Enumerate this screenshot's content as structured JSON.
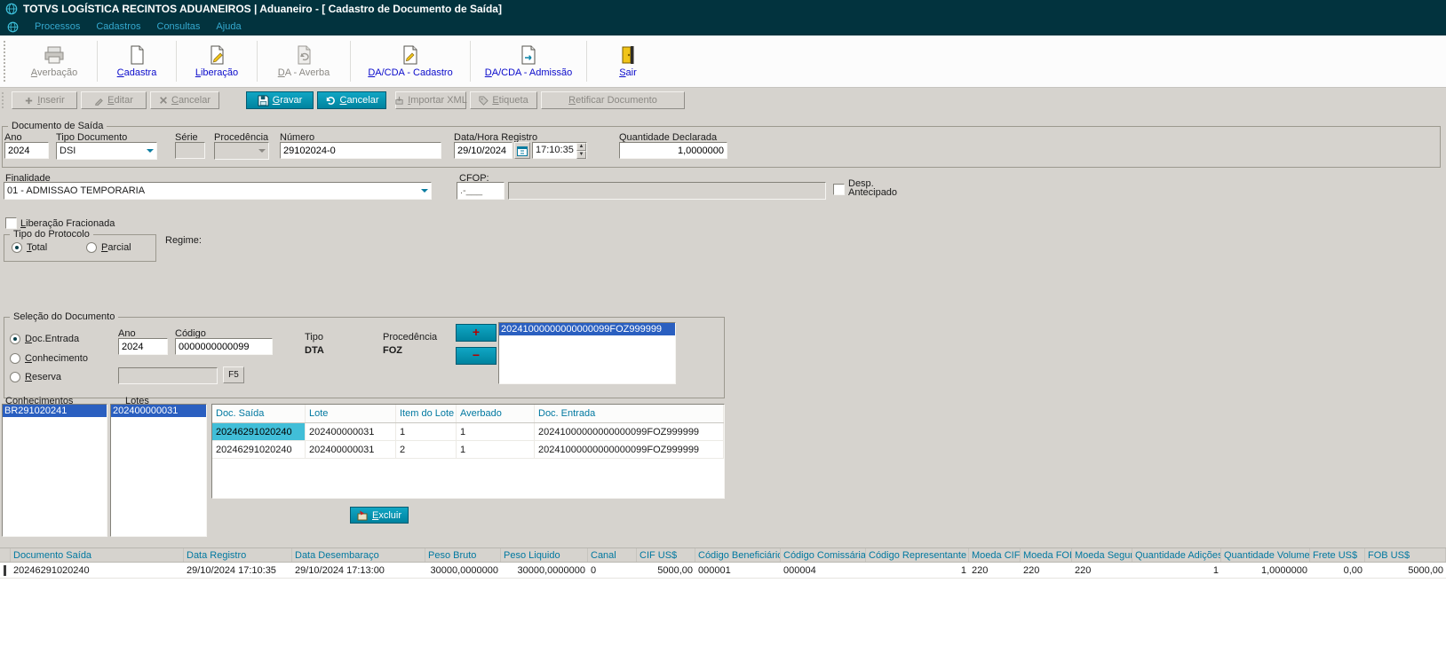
{
  "colors": {
    "titlebar_bg": "#02333e",
    "menu_text": "#35a9cf",
    "accent_teal": "#0093b2",
    "selection_blue": "#2a5fc0",
    "cell_highlight": "#41bed8",
    "grid_header_text": "#0078a0",
    "window_bg": "#d6d3ce"
  },
  "window": {
    "title": "TOTVS LOGÍSTICA RECINTOS ADUANEIROS | Aduaneiro - [ Cadastro de Documento de Saída]"
  },
  "menubar": {
    "items": [
      "Processos",
      "Cadastros",
      "Consultas",
      "Ajuda"
    ]
  },
  "toolbar": {
    "items": [
      {
        "label": "Averbação",
        "enabled": false
      },
      {
        "label": "Cadastra",
        "enabled": true
      },
      {
        "label": "Liberação",
        "enabled": true
      },
      {
        "label": "DA - Averba",
        "enabled": false
      },
      {
        "label": "DA/CDA - Cadastro",
        "enabled": true
      },
      {
        "label": "DA/CDA - Admissão",
        "enabled": true
      },
      {
        "label": "Sair",
        "enabled": true
      }
    ]
  },
  "actionbar": {
    "inserir": "Inserir",
    "editar": "Editar",
    "cancelar1": "Cancelar",
    "gravar": "Gravar",
    "cancelar2": "Cancelar",
    "importar_xml": "Importar XML",
    "etiqueta": "Etiqueta",
    "retificar": "Retificar Documento"
  },
  "doc_saida": {
    "group_label": "Documento de Saída",
    "ano": {
      "label": "Ano",
      "value": "2024"
    },
    "tipo_documento": {
      "label": "Tipo Documento",
      "value": "DSI"
    },
    "serie": {
      "label": "Série",
      "value": ""
    },
    "procedencia": {
      "label": "Procedência",
      "value": ""
    },
    "numero": {
      "label": "Número",
      "value": "29102024-0"
    },
    "data_hora": {
      "label": "Data/Hora Registro",
      "date": "29/10/2024",
      "time": "17:10:35"
    },
    "quantidade": {
      "label": "Quantidade Declarada",
      "value": "1,0000000"
    },
    "finalidade": {
      "label": "Finalidade",
      "value": "01 - ADMISSAO TEMPORARIA"
    },
    "cfop": {
      "label": "CFOP:",
      "mask": ".-___",
      "value": ""
    },
    "desp_antecipado": {
      "label_line1": "Desp.",
      "label_line2": "Antecipado",
      "checked": false
    },
    "liberacao_fracionada": {
      "label": "Liberação Fracionada",
      "checked": false
    },
    "tipo_protocolo": {
      "group_label": "Tipo do Protocolo",
      "total": "Total",
      "parcial": "Parcial",
      "selected": "Total"
    },
    "regime": {
      "label": "Regime:"
    }
  },
  "selecao": {
    "group_label": "Seleção do Documento",
    "radios": [
      "Doc.Entrada",
      "Conhecimento",
      "Reserva"
    ],
    "selected_radio": "Doc.Entrada",
    "ano": {
      "label": "Ano",
      "value": "2024"
    },
    "codigo": {
      "label": "Código",
      "value": "0000000000099"
    },
    "tipo": {
      "label": "Tipo",
      "value": "DTA"
    },
    "procedencia": {
      "label": "Procedência",
      "value": "FOZ"
    },
    "add_button": "+",
    "remove_button": "−",
    "documentos": [
      "20241000000000000099FOZ999999"
    ],
    "reserva_value": "",
    "f5_button": "F5"
  },
  "conhecimentos": {
    "label": "Conhecimentos",
    "items": [
      "BR291020241"
    ]
  },
  "lotes": {
    "label": "Lotes",
    "items": [
      "202400000031"
    ]
  },
  "detail_grid": {
    "headers": [
      "Doc. Saída",
      "Lote",
      "Item do Lote",
      "Averbado",
      "Doc. Entrada"
    ],
    "rows": [
      [
        "20246291020240",
        "202400000031",
        "1",
        "1",
        "20241000000000000099FOZ999999"
      ],
      [
        "20246291020240",
        "202400000031",
        "2",
        "1",
        "20241000000000000099FOZ999999"
      ]
    ]
  },
  "excluir_button": "Excluir",
  "bottom_grid": {
    "headers": [
      "Documento Saída",
      "Data Registro",
      "Data Desembaraço",
      "Peso Bruto",
      "Peso Liquido",
      "Canal",
      "CIF US$",
      "Código Beneficiário",
      "Código Comissária",
      "Código Representante",
      "Moeda CIF",
      "Moeda FOB",
      "Moeda Seguro",
      "Quantidade Adições",
      "Quantidade Volumes",
      "Frete US$",
      "FOB US$"
    ],
    "rows": [
      [
        "20246291020240",
        "29/10/2024 17:10:35",
        "29/10/2024 17:13:00",
        "30000,0000000",
        "30000,0000000",
        "0",
        "5000,00",
        "000001",
        "000004",
        "1",
        "220",
        "220",
        "220",
        "1",
        "1,0000000",
        "0,00",
        "5000,00"
      ]
    ]
  }
}
